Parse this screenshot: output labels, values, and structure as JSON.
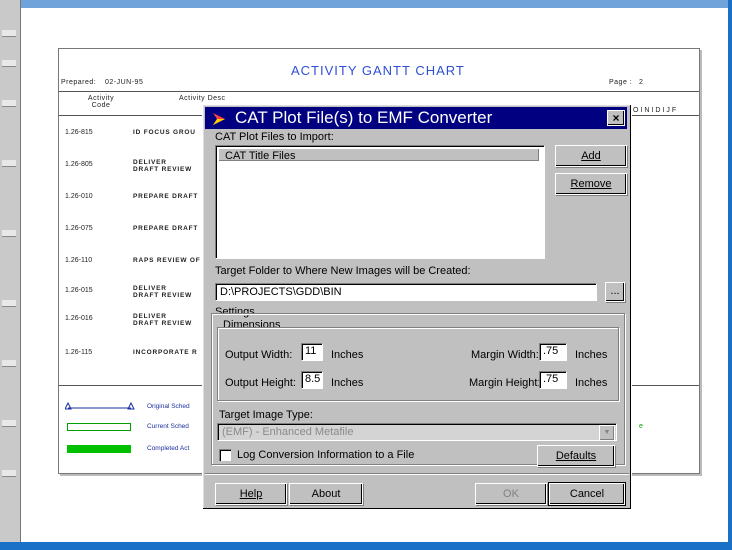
{
  "gantt": {
    "title": "ACTIVITY GANTT CHART",
    "prepared_label": "Prepared:",
    "prepared_date": "02-JUN-95",
    "page_label": "Page :",
    "page_number": "2",
    "col_activity_code": "Activity Code",
    "col_description": "Activity Desc",
    "right_header_letters": "OINIDIJF",
    "rows": [
      {
        "code": "1.26-815",
        "desc": "ID FOCUS GROU"
      },
      {
        "code": "1.26-805",
        "desc": "DELIVER DRAFT REVIEW"
      },
      {
        "code": "1.26-010",
        "desc": "PREPARE DRAFT"
      },
      {
        "code": "1.26-075",
        "desc": "PREPARE DRAFT"
      },
      {
        "code": "1.26-110",
        "desc": "RAPS REVIEW OF"
      },
      {
        "code": "1.26-015",
        "desc": "DELIVER DRAFT REVIEW"
      },
      {
        "code": "1.26-016",
        "desc": "DELIVER DRAFT REVIEW"
      },
      {
        "code": "1.26-115",
        "desc": "INCORPORATE R"
      }
    ],
    "legend": [
      {
        "label": "Original Sched"
      },
      {
        "label": "Current Sched"
      },
      {
        "label": "Completed Act"
      }
    ],
    "right_fragment": "e"
  },
  "dialog": {
    "title": "CAT Plot File(s) to EMF Converter",
    "close_label": "×",
    "import_label": "CAT Plot Files to Import:",
    "list_header": "CAT Title Files",
    "add_label": "Add",
    "remove_label": "Remove",
    "target_folder_label": "Target Folder to Where New Images will be Created:",
    "target_folder_value": "D:\\PROJECTS\\GDD\\BIN",
    "browse_label": "...",
    "settings_label": "Settings",
    "dimensions_label": "Dimensions",
    "output_width_label": "Output Width:",
    "output_width_value": "11",
    "output_height_label": "Output Height:",
    "output_height_value": "8.5",
    "inches_label": "Inches",
    "margin_width_label": "Margin Width:",
    "margin_width_value": ".75",
    "margin_height_label": "Margin Height:",
    "margin_height_value": ".75",
    "image_type_label": "Target Image Type:",
    "image_type_value": "(EMF) - Enhanced Metafile",
    "log_label": "Log Conversion Information to a File",
    "defaults_label": "Defaults",
    "help_label": "Help",
    "about_label": "About",
    "ok_label": "OK",
    "cancel_label": "Cancel"
  },
  "colors": {
    "title_bar": "#000080",
    "desktop": "#1a6fc7",
    "gantt_title": "#2f4fd6",
    "legend_green": "#00c000"
  }
}
